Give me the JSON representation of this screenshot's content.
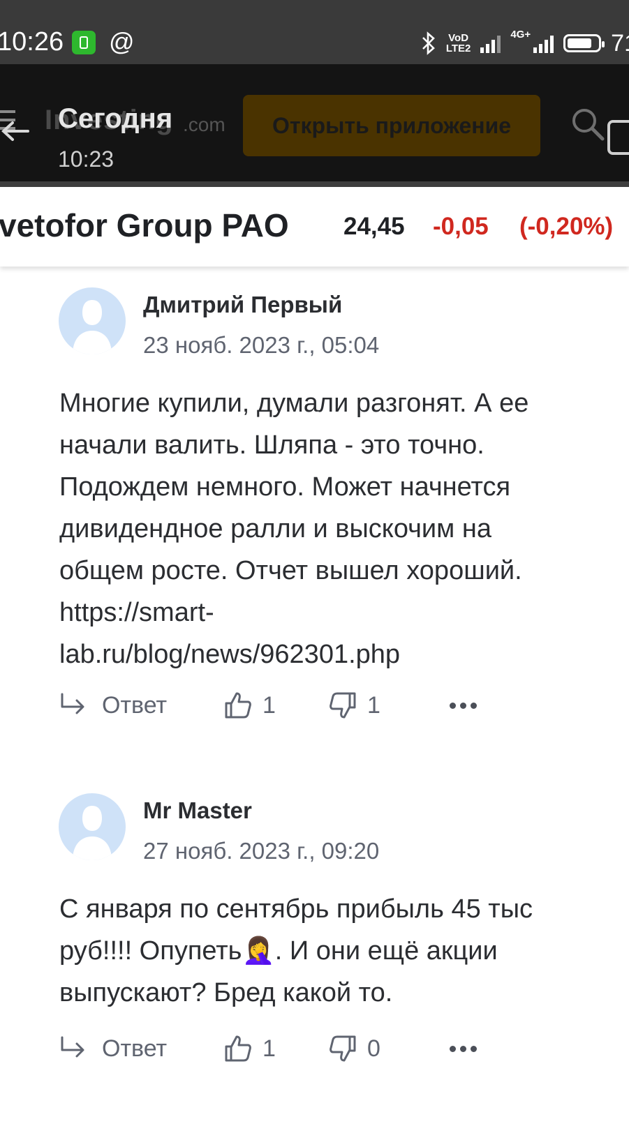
{
  "status_bar": {
    "time": "10:26",
    "at_symbol": "@",
    "network_vo": "VoD",
    "network_lte": "LTE2",
    "network_4g": "4G+",
    "battery_text": "71",
    "icons": [
      "app-notification-icon",
      "bluetooth-icon",
      "signal-icon",
      "battery-icon"
    ]
  },
  "app_bar": {
    "logo_text": "Investing",
    "logo_suffix": ".com",
    "title": "Сегодня",
    "subtitle": "10:23",
    "open_app_label": "Открыть приложение",
    "button_color": "#4a3300"
  },
  "instrument": {
    "name": "vetofor Group PAO",
    "price": "24,45",
    "change": "-0,05",
    "change_pct": "(-0,20%)",
    "negative_color": "#d0281f"
  },
  "comments": [
    {
      "author": "Дмитрий Первый",
      "date": "23 нояб. 2023 г., 05:04",
      "body_lines": [
        "Многие купили, думали разгонят. А ее",
        "начали валить. Шляпа - это точно.",
        "Подождем немного. Может начнется",
        "дивидендное ралли и выскочим на",
        "общем росте. Отчет вышел хороший.",
        "https://smart-",
        "lab.ru/blog/news/962301.php"
      ],
      "reply_label": "Ответ",
      "likes": "1",
      "dislikes": "1"
    },
    {
      "author": "Mr Master",
      "date": "27 нояб. 2023 г., 09:20",
      "body_lines": [
        "С января по сентябрь прибыль 45 тыс",
        "руб!!!! Опупеть🤦‍♀️. И они ещё акции",
        "выпускают? Бред какой то."
      ],
      "reply_label": "Ответ",
      "likes": "1",
      "dislikes": "0"
    }
  ]
}
